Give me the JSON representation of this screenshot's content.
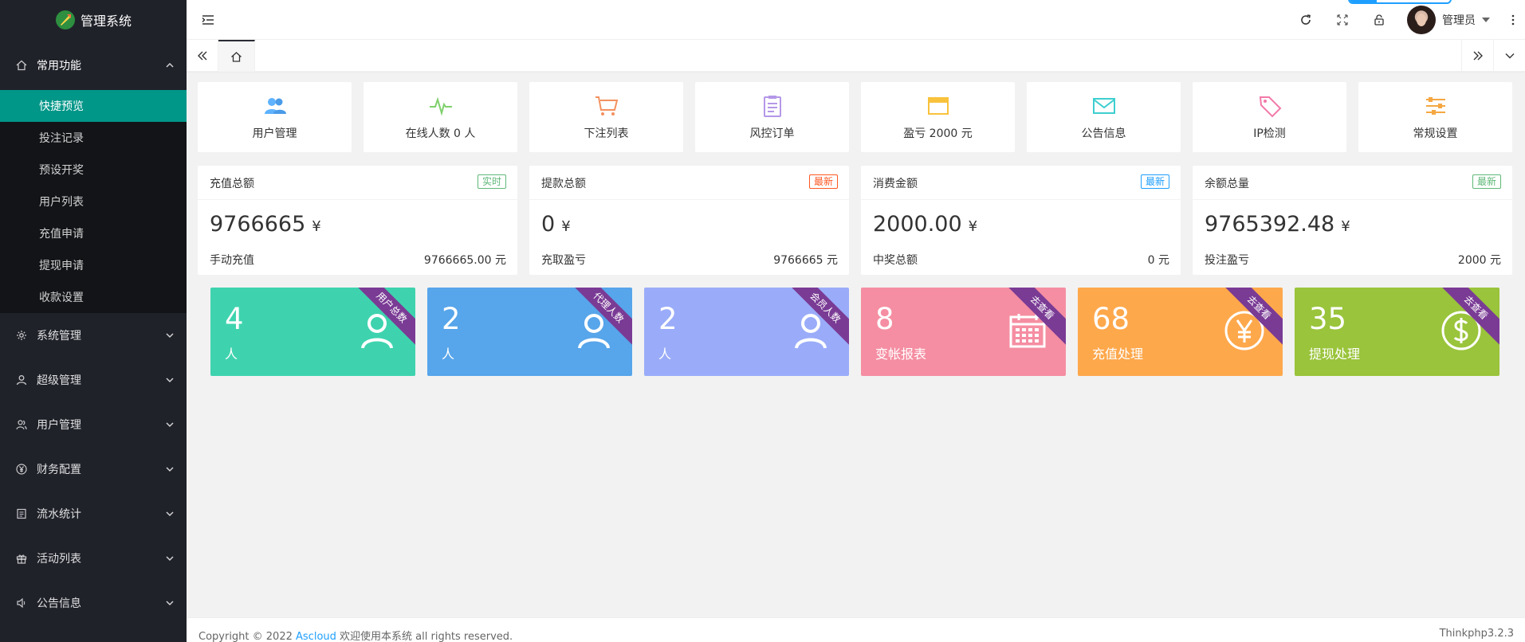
{
  "app": {
    "logo_text": "管理系统"
  },
  "sidebar": {
    "groups": [
      {
        "label": "常用功能",
        "icon": "home-icon",
        "open": true,
        "items": [
          {
            "label": "快捷预览",
            "active": true
          },
          {
            "label": "投注记录"
          },
          {
            "label": "预设开奖"
          },
          {
            "label": "用户列表"
          },
          {
            "label": "充值申请"
          },
          {
            "label": "提现申请"
          },
          {
            "label": "收款设置"
          }
        ]
      },
      {
        "label": "系统管理",
        "icon": "gear-icon"
      },
      {
        "label": "超级管理",
        "icon": "user-icon"
      },
      {
        "label": "用户管理",
        "icon": "users-icon"
      },
      {
        "label": "财务配置",
        "icon": "yen-icon"
      },
      {
        "label": "流水统计",
        "icon": "list-icon"
      },
      {
        "label": "活动列表",
        "icon": "gift-icon"
      },
      {
        "label": "公告信息",
        "icon": "speaker-icon"
      }
    ]
  },
  "header": {
    "user_name": "管理员",
    "actions": [
      "refresh-icon",
      "fullscreen-icon",
      "lock-icon",
      "more-icon"
    ]
  },
  "shortcuts": [
    {
      "label": "用户管理",
      "icon": "users-icon",
      "color": "#5eb2ff"
    },
    {
      "label": "在线人数 0 人",
      "icon": "pulse-icon",
      "color": "#7ed06b"
    },
    {
      "label": "下注列表",
      "icon": "cart-icon",
      "color": "#f3915f"
    },
    {
      "label": "风控订单",
      "icon": "clipboard-icon",
      "color": "#b497e8"
    },
    {
      "label": "盈亏 2000 元",
      "icon": "window-icon",
      "color": "#f9c23c"
    },
    {
      "label": "公告信息",
      "icon": "mail-icon",
      "color": "#3ecfcf"
    },
    {
      "label": "IP检测",
      "icon": "tag-icon",
      "color": "#f27aa9"
    },
    {
      "label": "常规设置",
      "icon": "sliders-icon",
      "color": "#f5a742"
    }
  ],
  "stats": [
    {
      "title": "充值总额",
      "badge": "实时",
      "badge_color": "#5fb878",
      "value": "9766665",
      "unit": "¥",
      "foot_label": "手动充值",
      "foot_value": "9766665.00 元"
    },
    {
      "title": "提款总额",
      "badge": "最新",
      "badge_color": "#ff5722",
      "value": "0",
      "unit": "¥",
      "foot_label": "充取盈亏",
      "foot_value": "9766665 元"
    },
    {
      "title": "消费金额",
      "badge": "最新",
      "badge_color": "#1e9fff",
      "value": "2000.00",
      "unit": "¥",
      "foot_label": "中奖总额",
      "foot_value": "0 元"
    },
    {
      "title": "余额总量",
      "badge": "最新",
      "badge_color": "#5fb878",
      "value": "9765392.48",
      "unit": "¥",
      "foot_label": "投注盈亏",
      "foot_value": "2000 元"
    }
  ],
  "cards": [
    {
      "value": "4",
      "label": "人",
      "ribbon": "用户总数",
      "icon": "user-outline-icon",
      "color": "#3ed3ae"
    },
    {
      "value": "2",
      "label": "人",
      "ribbon": "代理人数",
      "icon": "user-outline-icon",
      "color": "#57a5ea"
    },
    {
      "value": "2",
      "label": "人",
      "ribbon": "会员人数",
      "icon": "user-outline-icon",
      "color": "#9aacf9"
    },
    {
      "value": "8",
      "label": "变帐报表",
      "ribbon": "去查看",
      "icon": "calendar-icon",
      "color": "#f58ea2"
    },
    {
      "value": "68",
      "label": "充值处理",
      "ribbon": "去查看",
      "icon": "yen-circle-icon",
      "color": "#fea84c"
    },
    {
      "value": "35",
      "label": "提现处理",
      "ribbon": "去查看",
      "icon": "dollar-circle-icon",
      "color": "#9ac43b"
    }
  ],
  "footer": {
    "copyright_prefix": "Copyright © 2022",
    "brand": "Ascloud",
    "copyright_suffix": "欢迎使用本系统 all rights reserved.",
    "version": "Thinkphp3.2.3"
  }
}
